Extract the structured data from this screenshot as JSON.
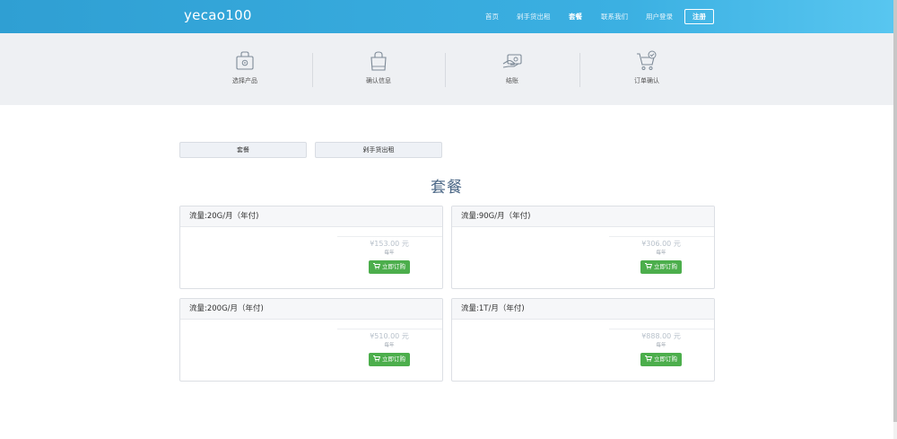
{
  "brand": "yecao100",
  "nav": {
    "items": [
      {
        "label": "首页"
      },
      {
        "label": "剁手货出租"
      },
      {
        "label": "套餐"
      },
      {
        "label": "联系我们"
      },
      {
        "label": "用户登录"
      }
    ],
    "register": "注册"
  },
  "steps": [
    {
      "label": "选择产品",
      "icon": "product-box-icon"
    },
    {
      "label": "确认信息",
      "icon": "shopping-bag-icon"
    },
    {
      "label": "结账",
      "icon": "payment-card-icon"
    },
    {
      "label": "订单确认",
      "icon": "cart-check-icon"
    }
  ],
  "tabs": [
    {
      "label": "套餐"
    },
    {
      "label": "剁手货出租"
    }
  ],
  "section_title": "套餐",
  "plans": [
    {
      "name": "流量:20G/月（年付)",
      "price": "¥153.00 元",
      "period": "每年",
      "button": "立即订购"
    },
    {
      "name": "流量:90G/月（年付)",
      "price": "¥306.00 元",
      "period": "每年",
      "button": "立即订购"
    },
    {
      "name": "流量:200G/月（年付)",
      "price": "¥510.00 元",
      "period": "每年",
      "button": "立即订购"
    },
    {
      "name": "流量:1T/月（年付)",
      "price": "¥888.00 元",
      "period": "每年",
      "button": "立即订购"
    }
  ],
  "colors": {
    "header_start": "#2f9fd3",
    "header_end": "#58c6f0",
    "buy_button": "#4cae4c",
    "title": "#4a6685"
  }
}
